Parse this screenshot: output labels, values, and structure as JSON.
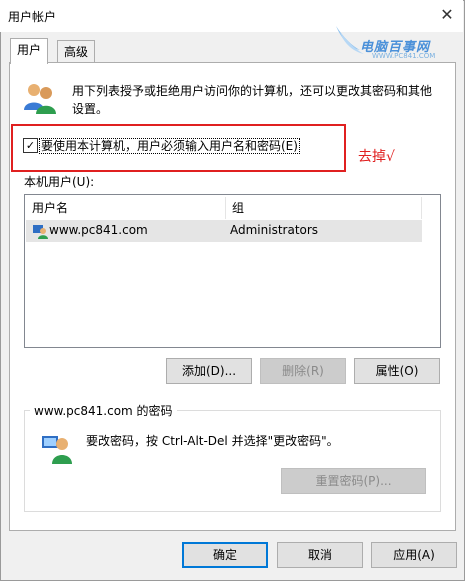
{
  "window": {
    "title": "用户帐户"
  },
  "tabs": [
    {
      "label": "用户"
    },
    {
      "label": "高级"
    }
  ],
  "watermark": {
    "brand": "电脑百事网",
    "url": "WWW.PC841.COM"
  },
  "intro": {
    "text": "用下列表授予或拒绝用户访问你的计算机，还可以更改其密码和其他设置。"
  },
  "require_login": {
    "label": "要使用本计算机，用户必须输入用户名和密码(E)",
    "checked": true
  },
  "annotation": {
    "text": "去掉√"
  },
  "users": {
    "label": "本机用户(U):",
    "columns": [
      "用户名",
      "组"
    ],
    "rows": [
      {
        "name": "www.pc841.com",
        "group": "Administrators"
      }
    ]
  },
  "user_buttons": {
    "add": "添加(D)...",
    "remove": "删除(R)",
    "properties": "属性(O)"
  },
  "password_group": {
    "title": "www.pc841.com 的密码",
    "text": "要改密码，按 Ctrl-Alt-Del 并选择\"更改密码\"。",
    "reset_button": "重置密码(P)..."
  },
  "dialog_buttons": {
    "ok": "确定",
    "cancel": "取消",
    "apply": "应用(A)"
  },
  "colors": {
    "annotation_red": "#e02020",
    "accent": "#0078d7"
  }
}
